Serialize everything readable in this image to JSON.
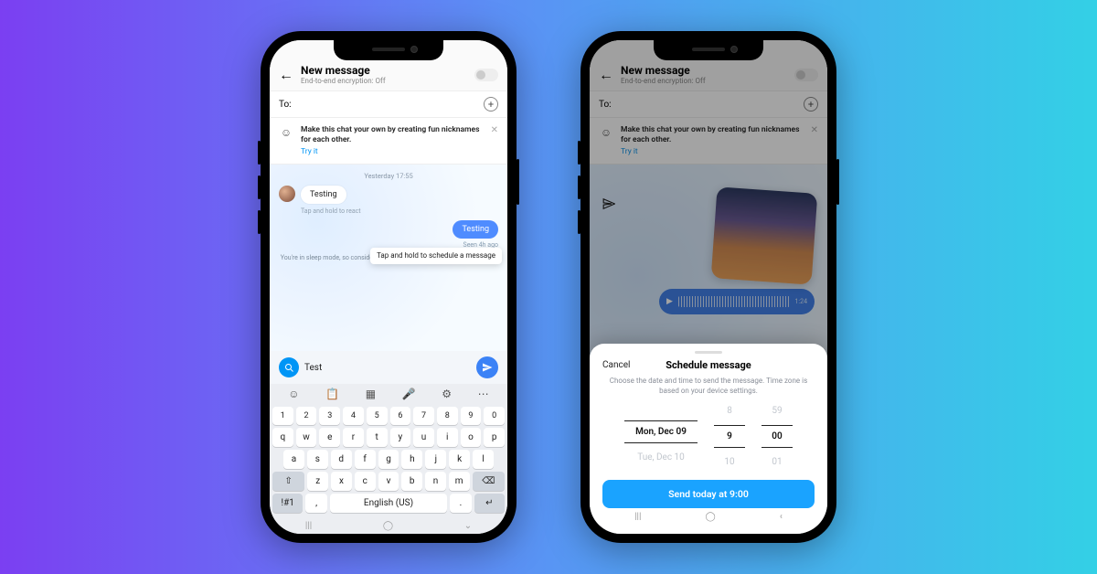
{
  "left": {
    "header": {
      "title": "New message",
      "subtitle": "End-to-end encryption: Off"
    },
    "to_label": "To:",
    "banner": {
      "text": "Make this chat your own by creating fun nicknames for each other.",
      "cta": "Try it"
    },
    "timestamp": "Yesterday 17:55",
    "incoming": "Testing",
    "react_hint": "Tap and hold to react",
    "outgoing": "Testing",
    "seen": "Seen 4h ago",
    "sleep_notice": "You're in sleep mode, so consider closing Instagram. We'll notify you later ab",
    "tooltip": "Tap and hold to schedule a message",
    "input_value": "Test",
    "keyboard": {
      "nums": [
        "1",
        "2",
        "3",
        "4",
        "5",
        "6",
        "7",
        "8",
        "9",
        "0"
      ],
      "r1": [
        "q",
        "w",
        "e",
        "r",
        "t",
        "y",
        "u",
        "i",
        "o",
        "p"
      ],
      "r2": [
        "a",
        "s",
        "d",
        "f",
        "g",
        "h",
        "j",
        "k",
        "l"
      ],
      "r3": [
        "z",
        "x",
        "c",
        "v",
        "b",
        "n",
        "m"
      ],
      "shift": "⇧",
      "bksp": "⌫",
      "sym": "!#1",
      "comma": ",",
      "space": "English (US)",
      "dot": ".",
      "enter": "↵"
    }
  },
  "right": {
    "header": {
      "title": "New message",
      "subtitle": "End-to-end encryption: Off"
    },
    "to_label": "To:",
    "banner": {
      "text": "Make this chat your own by creating fun nicknames for each other.",
      "cta": "Try it"
    },
    "voice_duration": "1:24",
    "sheet": {
      "cancel": "Cancel",
      "title": "Schedule message",
      "desc": "Choose the date and time to send the message. Time zone is based on your device settings.",
      "picker": {
        "date": {
          "prev": "",
          "sel": "Mon, Dec 09",
          "next": "Tue, Dec 10"
        },
        "hour": {
          "prev": "8",
          "sel": "9",
          "next": "10"
        },
        "minute": {
          "prev": "59",
          "sel": "00",
          "next": "01"
        }
      },
      "button": "Send today at 9:00"
    }
  }
}
